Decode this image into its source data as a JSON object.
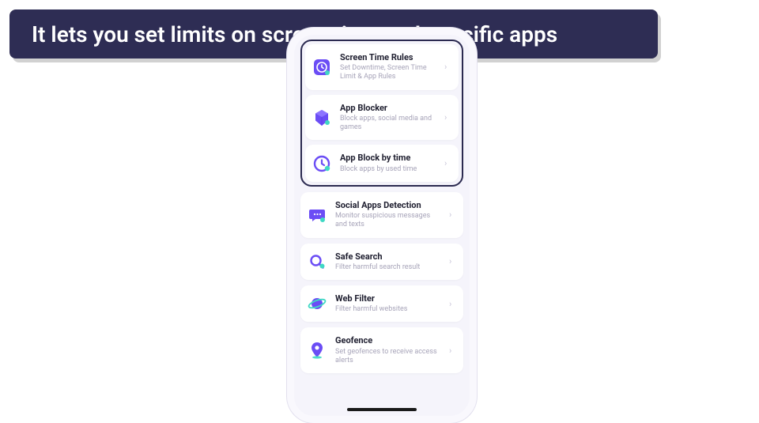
{
  "banner": {
    "text": "It lets you set limits on screen time and specific apps"
  },
  "phone": {
    "highlighted": [
      {
        "icon": "clock-box-icon",
        "title": "Screen Time Rules",
        "sub": "Set Downtime, Screen Time Limit & App Rules"
      },
      {
        "icon": "cube-icon",
        "title": "App Blocker",
        "sub": "Block apps, social media and games"
      },
      {
        "icon": "clock-icon",
        "title": "App Block by time",
        "sub": "Block apps by used time"
      }
    ],
    "rest": [
      {
        "icon": "chat-icon",
        "title": "Social Apps Detection",
        "sub": "Monitor suspicious messages and texts"
      },
      {
        "icon": "search-icon",
        "title": "Safe Search",
        "sub": "Filter harmful search result"
      },
      {
        "icon": "planet-icon",
        "title": "Web Filter",
        "sub": "Filter harmful websites"
      },
      {
        "icon": "pin-icon",
        "title": "Geofence",
        "sub": "Set geofences to receive access alerts"
      }
    ]
  },
  "colors": {
    "accent": "#6b4df5",
    "accent2": "#3fd8c4"
  }
}
